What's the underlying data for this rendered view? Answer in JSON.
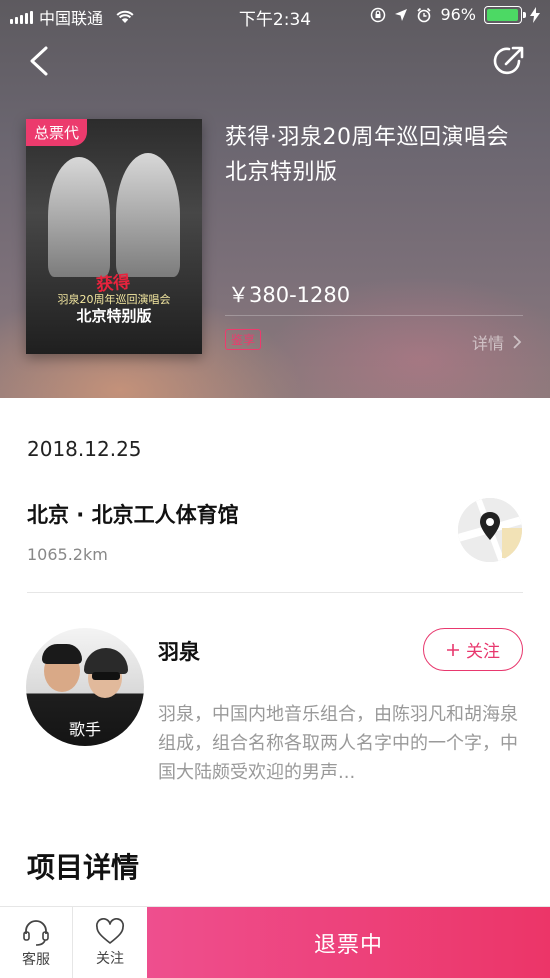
{
  "status_bar": {
    "carrier": "中国联通",
    "time": "下午2:34",
    "battery_percent": "96%",
    "battery_level": 0.96
  },
  "hero": {
    "poster_tag": "总票代",
    "poster_logo": "获得",
    "poster_line1": "羽泉20周年巡回演唱会",
    "poster_line2": "北京特别版",
    "title": "获得·羽泉20周年巡回演唱会北京特别版",
    "price": "￥380-1280",
    "badge": "鉴享",
    "detail_label": "详情"
  },
  "event": {
    "date": "2018.12.25",
    "venue": "北京 · 北京工人体育馆",
    "distance": "1065.2km"
  },
  "artist": {
    "avatar_label": "歌手",
    "name": "羽泉",
    "follow_label": "关注",
    "description": "羽泉，中国内地音乐组合，由陈羽凡和胡海泉组成，组合名称各取两人名字中的一个字，中国大陆颇受欢迎的男声..."
  },
  "section": {
    "title": "项目详情"
  },
  "bottom_bar": {
    "service_label": "客服",
    "follow_label": "关注",
    "action_label": "退票中"
  },
  "colors": {
    "accent": "#ec3b6d",
    "battery": "#4cd964"
  }
}
